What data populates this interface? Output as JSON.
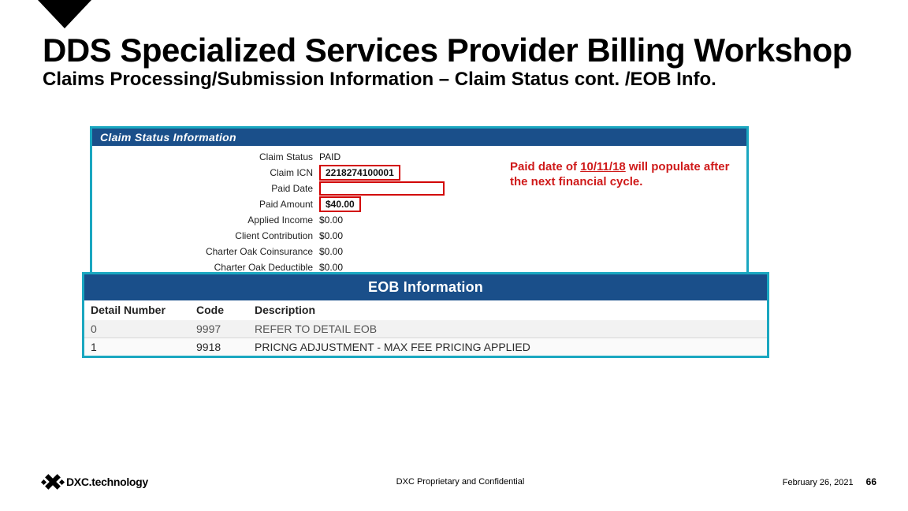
{
  "header": {
    "title": "DDS Specialized Services Provider Billing Workshop",
    "subtitle": "Claims Processing/Submission Information – Claim Status cont. /EOB Info."
  },
  "claim_status": {
    "panel_title": "Claim Status Information",
    "rows": {
      "status_label": "Claim Status",
      "status_value": "PAID",
      "icn_label": "Claim ICN",
      "icn_value": "2218274100001",
      "paid_date_label": "Paid Date",
      "paid_date_value": "",
      "paid_amount_label": "Paid Amount",
      "paid_amount_value": "$40.00",
      "applied_income_label": "Applied Income",
      "applied_income_value": "$0.00",
      "client_contrib_label": "Client Contribution",
      "client_contrib_value": "$0.00",
      "co_coins_label": "Charter Oak Coinsurance",
      "co_coins_value": "$0.00",
      "co_deduct_label": "Charter Oak Deductible",
      "co_deduct_value": "$0.00"
    },
    "annotation": {
      "pre": "Paid date of ",
      "date": "10/11/18",
      "post": " will populate after the next financial cycle."
    }
  },
  "eob": {
    "panel_title": "EOB Information",
    "headers": {
      "detail": "Detail Number",
      "code": "Code",
      "desc": "Description"
    },
    "rows": [
      {
        "detail": "0",
        "code": "9997",
        "desc": "REFER TO DETAIL EOB"
      },
      {
        "detail": "1",
        "code": "9918",
        "desc": "PRICNG ADJUSTMENT - MAX FEE PRICING APPLIED"
      }
    ]
  },
  "footer": {
    "logo_text": "DXC.technology",
    "center": "DXC Proprietary and Confidential",
    "date": "February 26, 2021",
    "page": "66"
  }
}
